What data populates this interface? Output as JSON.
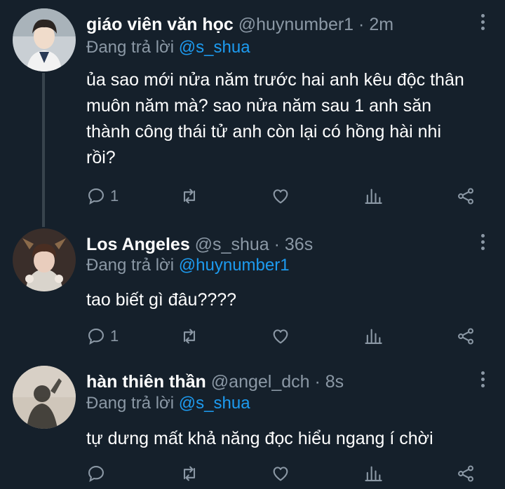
{
  "tweets": [
    {
      "name": "giáo viên văn học",
      "handle": "@huynumber1",
      "time": "2m",
      "reply_prefix": "Đang trả lời",
      "reply_to": "@s_shua",
      "text_lines": [
        "ủa sao mới nửa năm trước hai anh kêu độc thân",
        "muôn năm mà? sao nửa năm sau 1 anh săn",
        "thành công thái tử anh còn lại có hồng hài nhi",
        "rồi?"
      ],
      "reply_count": "1"
    },
    {
      "name": "Los Angeles",
      "handle": "@s_shua",
      "time": "36s",
      "reply_prefix": "Đang trả lời",
      "reply_to": "@huynumber1",
      "text_lines": [
        "tao biết gì đâu????"
      ],
      "reply_count": "1"
    },
    {
      "name": "hàn thiên thần",
      "handle": "@angel_dch",
      "time": "8s",
      "reply_prefix": "Đang trả lời",
      "reply_to": "@s_shua",
      "text_lines": [
        "tự dưng mất khả năng đọc hiểu ngang í chời"
      ],
      "reply_count": ""
    }
  ],
  "separator": "·",
  "colors": {
    "background": "#15202b",
    "secondary_text": "#8b98a5",
    "link": "#1d9bf0",
    "thread_line": "#38444d"
  },
  "icons": [
    "reply-icon",
    "retweet-icon",
    "like-icon",
    "analytics-icon",
    "share-icon",
    "more-icon"
  ]
}
